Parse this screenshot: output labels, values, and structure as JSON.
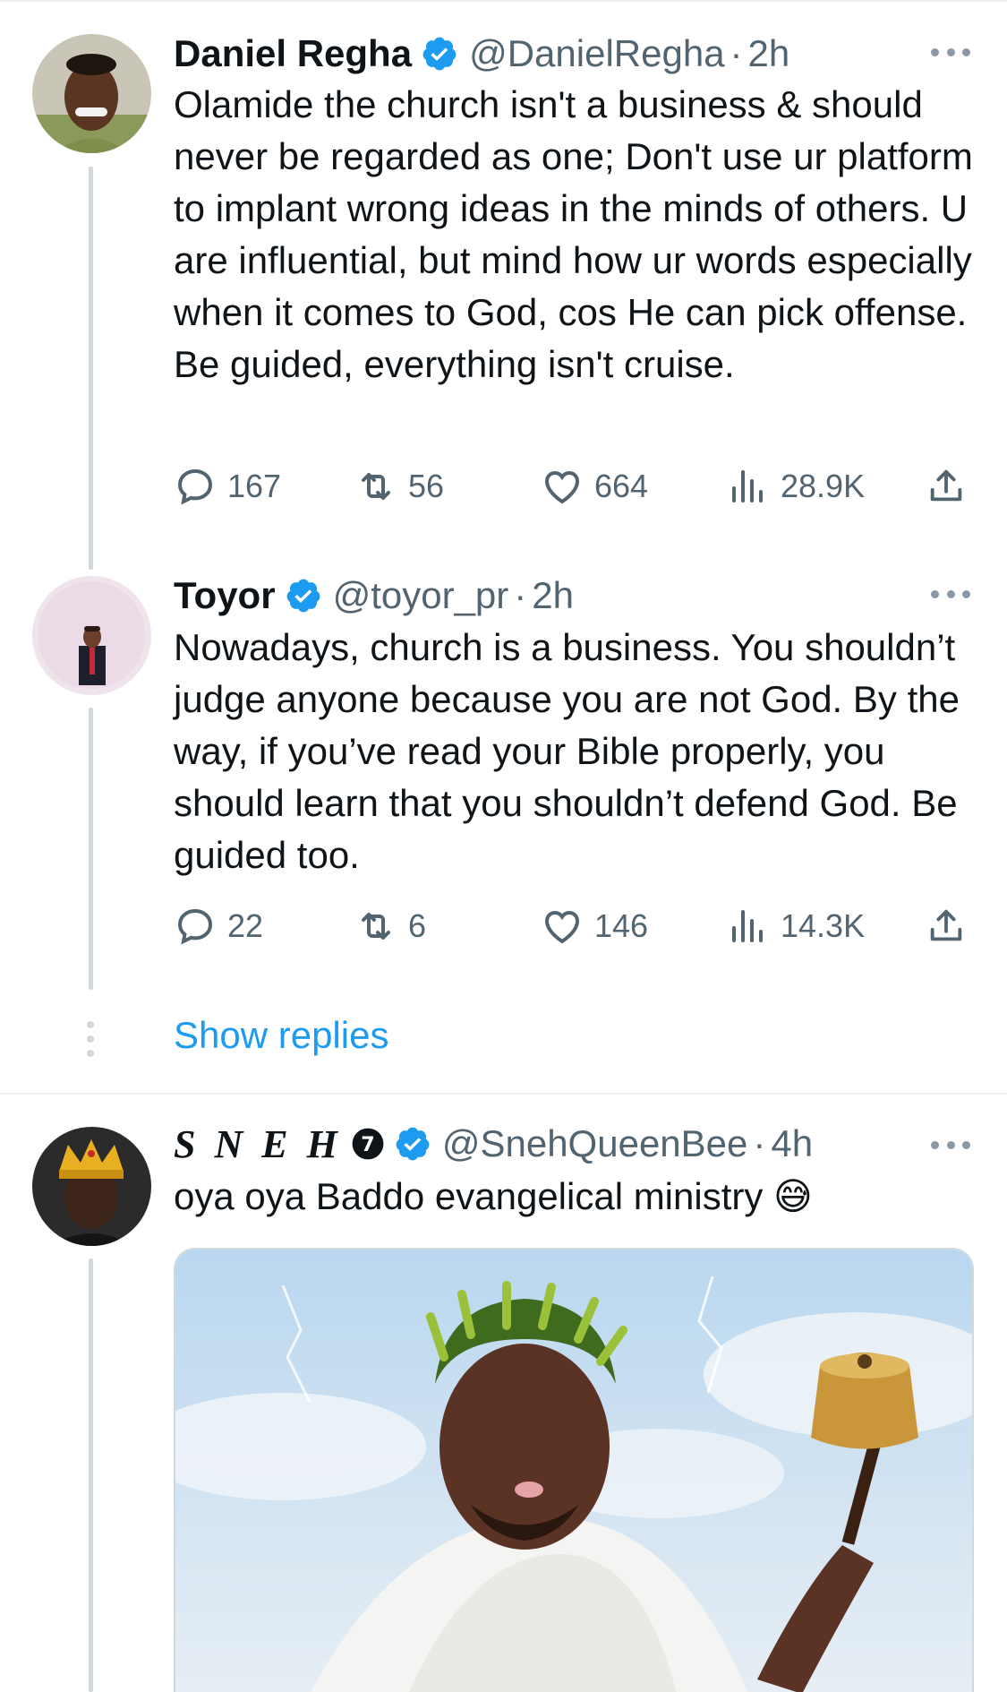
{
  "tweets": [
    {
      "author": "Daniel Regha",
      "handle": "@DanielRegha",
      "time": "2h",
      "text": "Olamide the church isn't a business & should never be regarded as one; Don't use ur platform to implant wrong ideas in the minds of others. U are influential, but mind how ur words especially when it comes to God, cos He can pick offense. Be guided, everything isn't cruise.",
      "replies": "167",
      "retweets": "56",
      "likes": "664",
      "views": "28.9K"
    },
    {
      "author": "Toyor",
      "handle": "@toyor_pr",
      "time": "2h",
      "text": "Nowadays,  church is a business. You shouldn’t judge anyone because you are not God. By the way, if you’ve read your Bible properly, you should learn that you shouldn’t defend God. Be guided too.",
      "replies": "22",
      "retweets": "6",
      "likes": "146",
      "views": "14.3K"
    },
    {
      "author": "S N E H",
      "badge": "7",
      "handle": "@SnehQueenBee",
      "time": "4h",
      "text": "oya oya Baddo evangelical ministry 😅"
    }
  ],
  "show_replies_label": "Show replies",
  "colors": {
    "verified": "#1d9bf0",
    "link": "#1d9bf0",
    "muted": "#536471",
    "thread_line": "#cfd9de"
  },
  "icons": [
    "reply-icon",
    "retweet-icon",
    "like-icon",
    "views-icon",
    "share-icon",
    "more-icon",
    "verified-badge-icon"
  ]
}
